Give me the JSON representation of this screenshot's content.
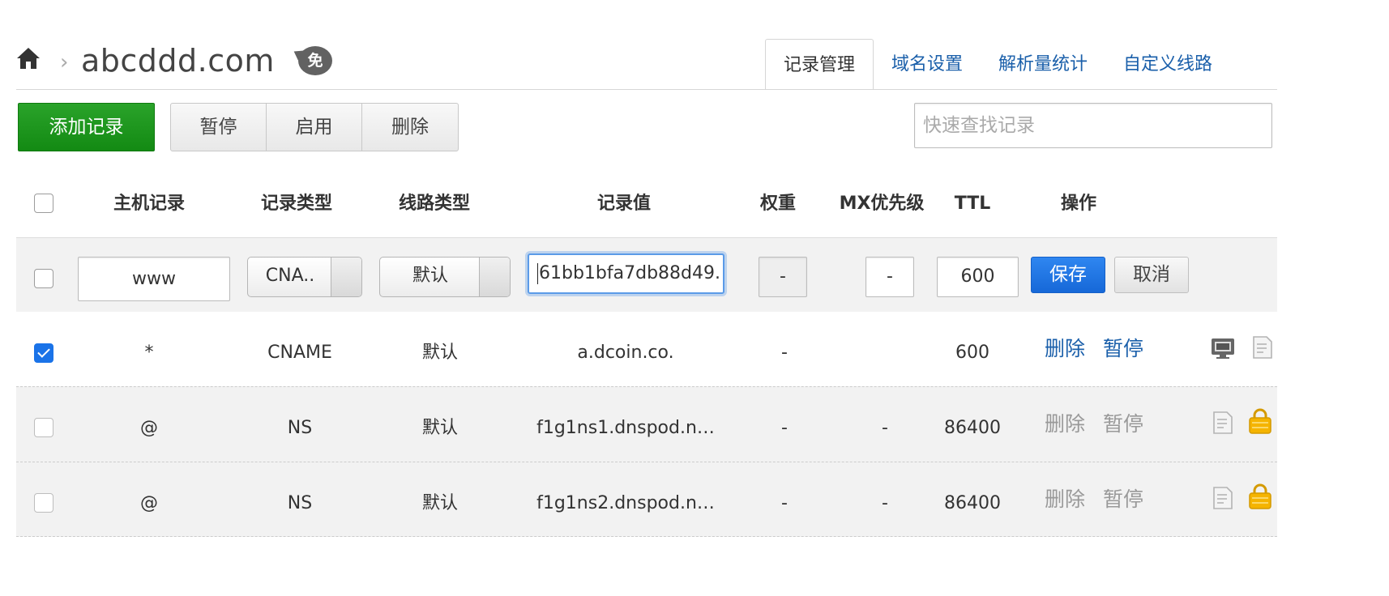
{
  "header": {
    "domain": "abcddd.com",
    "breadcrumb_sep": "›",
    "free_badge": "免"
  },
  "tabs": [
    {
      "label": "记录管理",
      "active": true
    },
    {
      "label": "域名设置",
      "active": false
    },
    {
      "label": "解析量统计",
      "active": false
    },
    {
      "label": "自定义线路",
      "active": false
    }
  ],
  "toolbar": {
    "add_label": "添加记录",
    "pause_label": "暂停",
    "enable_label": "启用",
    "delete_label": "删除",
    "search_placeholder": "快速查找记录",
    "search_value": ""
  },
  "table": {
    "headers": {
      "host": "主机记录",
      "type": "记录类型",
      "line": "线路类型",
      "value": "记录值",
      "weight": "权重",
      "mx": "MX优先级",
      "ttl": "TTL",
      "ops": "操作"
    },
    "edit_row": {
      "host": "www",
      "type": "CNA..",
      "line": "默认",
      "value": "61bb1bfa7db88d49.",
      "weight": "-",
      "mx": "-",
      "ttl": "600",
      "save_label": "保存",
      "cancel_label": "取消"
    },
    "rows": [
      {
        "checked": true,
        "host": "*",
        "type": "CNAME",
        "line": "默认",
        "value": "a.dcoin.co.",
        "weight": "-",
        "mx": "",
        "ttl": "600",
        "delete": "删除",
        "pause": "暂停",
        "enabled": true
      },
      {
        "checked": false,
        "host": "@",
        "type": "NS",
        "line": "默认",
        "value": "f1g1ns1.dnspod.n…",
        "weight": "-",
        "mx": "-",
        "ttl": "86400",
        "delete": "删除",
        "pause": "暂停",
        "enabled": false
      },
      {
        "checked": false,
        "host": "@",
        "type": "NS",
        "line": "默认",
        "value": "f1g1ns2.dnspod.n…",
        "weight": "-",
        "mx": "-",
        "ttl": "86400",
        "delete": "删除",
        "pause": "暂停",
        "enabled": false
      }
    ]
  },
  "colors": {
    "accent_green": "#1f9a1f",
    "link_blue": "#1a5faa",
    "save_blue": "#1a73e8",
    "lock_yellow": "#f5b400"
  }
}
